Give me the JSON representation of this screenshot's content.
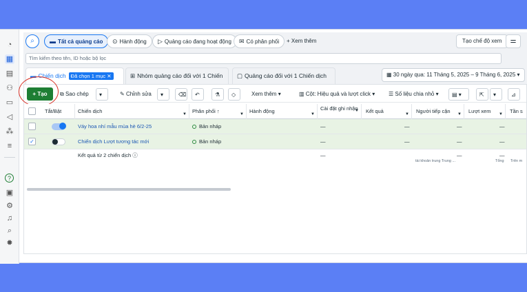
{
  "rail_icons": [
    "dashboard-icon",
    "table-icon",
    "pages-icon",
    "people-icon",
    "billing-icon",
    "megaphone-icon",
    "audience-icon",
    "menu-icon",
    "help-icon",
    "calendar-icon",
    "settings-icon",
    "bell-icon",
    "search-icon",
    "bug-icon"
  ],
  "filters": {
    "all_ads": "Tất cả quảng cáo",
    "actions": "Hành động",
    "active_ads": "Quảng cáo đang hoạt động",
    "has_delivery": "Có phân phối",
    "add_more": "Xem thêm",
    "create_view": "Tạo chế độ xem"
  },
  "search": {
    "placeholder": "Tìm kiếm theo tên, ID hoặc bộ lọc"
  },
  "tabs": {
    "campaigns": "Chiến dịch",
    "selected_chip": "Đã chọn 1 mục",
    "adsets": "Nhóm quảng cáo đối với 1 Chiến",
    "ads": "Quảng cáo đối với 1 Chiến dịch"
  },
  "date_range": "30 ngày qua: 11 Tháng 5, 2025 – 9 Tháng 6, 2025",
  "toolbar": {
    "create": "Tạo",
    "duplicate": "Sao chép",
    "edit": "Chỉnh sửa",
    "view_more": "Xem thêm",
    "columns": "Cột: Hiệu quả và lượt click",
    "breakdown": "Số liệu chia nhỏ"
  },
  "columns": {
    "toggle": "Tắt/Bật",
    "campaign": "Chiến dịch",
    "delivery": "Phân phối ↑",
    "actions": "Hành động",
    "attribution": "Cài đặt ghi nhận",
    "results": "Kết quả",
    "reach": "Người tiếp cận",
    "impressions": "Lượt xem",
    "frequency": "Tần s"
  },
  "rows": [
    {
      "name": "Váy hoa nhí mẫu mùa hè 6/2-25",
      "delivery": "Bản nháp",
      "attribution": "—",
      "results": "—",
      "reach": "—",
      "impressions": "—",
      "checked": false,
      "on": true
    },
    {
      "name": "Chiến dịch Lượt tương tác mới",
      "delivery": "Bản nháp",
      "attribution": "—",
      "results": "—",
      "reach": "—",
      "impressions": "—",
      "checked": true,
      "on": false
    }
  ],
  "summary": {
    "label": "Kết quả từ 2 chiến dịch",
    "attribution": "—",
    "reach": "—",
    "reach_sub": "tài khoản trung Trung ...",
    "impressions": "—",
    "impressions_sub": "Tổng",
    "frequency_sub": "Trên m"
  }
}
